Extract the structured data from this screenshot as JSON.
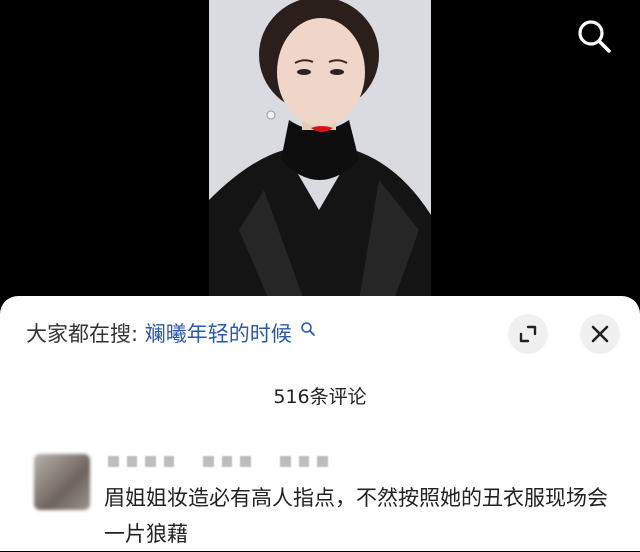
{
  "sheet": {
    "suggest_prefix": "大家都在搜",
    "suggest_sep": ":",
    "suggest_keyword": "斓曦年轻的时候",
    "comment_count": "516条评论"
  },
  "comment": {
    "text": "眉姐姐妆造必有高人指点，不然按照她的丑衣服现场会一片狼藉"
  },
  "icons": [
    "search-icon",
    "small-search-icon",
    "expand-icon",
    "close-icon"
  ],
  "colors": {
    "keyword": "#2a5aa8",
    "background": "#000000",
    "sheet": "#ffffff"
  }
}
